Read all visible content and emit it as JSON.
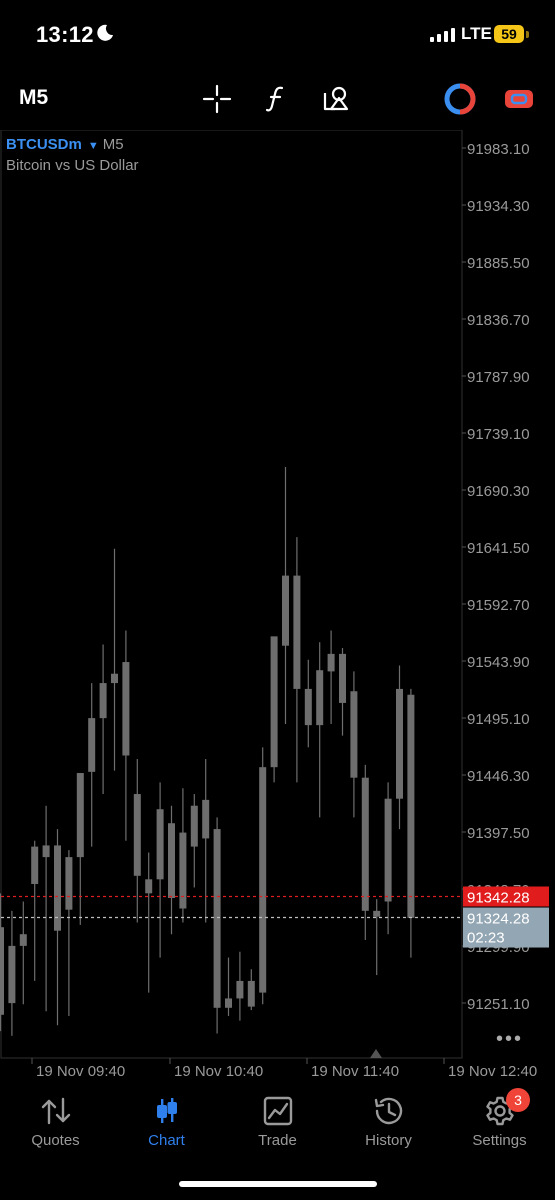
{
  "status_bar": {
    "time": "13:12",
    "network": "LTE",
    "battery": "59"
  },
  "toolbar": {
    "timeframe": "M5",
    "icons": [
      "crosshair-icon",
      "function-icon",
      "objects-icon",
      "trade-icon",
      "one-click-icon"
    ]
  },
  "chart": {
    "symbol": "BTCUSDm",
    "timeframe": "M5",
    "description": "Bitcoin vs US Dollar",
    "current_price": "91342.28",
    "second_price": "91324.28",
    "countdown": "02:23",
    "more_label": "•••"
  },
  "chart_data": {
    "type": "candlestick",
    "title": "",
    "y_ticks": [
      "91983.10",
      "91934.30",
      "91885.50",
      "91836.70",
      "91787.90",
      "91739.10",
      "91690.30",
      "91641.50",
      "91592.70",
      "91543.90",
      "91495.10",
      "91446.30",
      "91397.50",
      "91348.70",
      "91299.90",
      "91251.10"
    ],
    "x_ticks": [
      "19 Nov 09:40",
      "19 Nov 10:40",
      "19 Nov 11:40",
      "19 Nov 12:40"
    ],
    "ylim": [
      91225,
      92005
    ],
    "ask_line": 91342.28,
    "bid_line": 91324.28,
    "candles": [
      {
        "o": 91316,
        "h": 91345,
        "l": 91227,
        "c": 91241
      },
      {
        "o": 91251,
        "h": 91330,
        "l": 91223,
        "c": 91300
      },
      {
        "o": 91300,
        "h": 91338,
        "l": 91250,
        "c": 91310
      },
      {
        "o": 91353,
        "h": 91390,
        "l": 91270,
        "c": 91385
      },
      {
        "o": 91376,
        "h": 91420,
        "l": 91244,
        "c": 91386
      },
      {
        "o": 91386,
        "h": 91400,
        "l": 91232,
        "c": 91313
      },
      {
        "o": 91331,
        "h": 91382,
        "l": 91240,
        "c": 91376
      },
      {
        "o": 91376,
        "h": 91435,
        "l": 91318,
        "c": 91448
      },
      {
        "o": 91449,
        "h": 91525,
        "l": 91385,
        "c": 91495
      },
      {
        "o": 91495,
        "h": 91558,
        "l": 91430,
        "c": 91525
      },
      {
        "o": 91525,
        "h": 91640,
        "l": 91450,
        "c": 91533
      },
      {
        "o": 91543,
        "h": 91570,
        "l": 91390,
        "c": 91463
      },
      {
        "o": 91430,
        "h": 91460,
        "l": 91320,
        "c": 91360
      },
      {
        "o": 91345,
        "h": 91380,
        "l": 91260,
        "c": 91357
      },
      {
        "o": 91357,
        "h": 91440,
        "l": 91290,
        "c": 91417
      },
      {
        "o": 91405,
        "h": 91420,
        "l": 91310,
        "c": 91341
      },
      {
        "o": 91332,
        "h": 91435,
        "l": 91320,
        "c": 91397
      },
      {
        "o": 91385,
        "h": 91430,
        "l": 91350,
        "c": 91420
      },
      {
        "o": 91425,
        "h": 91460,
        "l": 91320,
        "c": 91392
      },
      {
        "o": 91400,
        "h": 91410,
        "l": 91225,
        "c": 91247
      },
      {
        "o": 91247,
        "h": 91290,
        "l": 91240,
        "c": 91255
      },
      {
        "o": 91255,
        "h": 91295,
        "l": 91236,
        "c": 91270
      },
      {
        "o": 91270,
        "h": 91280,
        "l": 91245,
        "c": 91248
      },
      {
        "o": 91260,
        "h": 91470,
        "l": 91250,
        "c": 91453
      },
      {
        "o": 91453,
        "h": 91545,
        "l": 91440,
        "c": 91565
      },
      {
        "o": 91557,
        "h": 91710,
        "l": 91490,
        "c": 91617
      },
      {
        "o": 91617,
        "h": 91650,
        "l": 91440,
        "c": 91520
      },
      {
        "o": 91520,
        "h": 91545,
        "l": 91470,
        "c": 91489
      },
      {
        "o": 91489,
        "h": 91560,
        "l": 91410,
        "c": 91536
      },
      {
        "o": 91550,
        "h": 91570,
        "l": 91490,
        "c": 91535
      },
      {
        "o": 91550,
        "h": 91555,
        "l": 91480,
        "c": 91508
      },
      {
        "o": 91518,
        "h": 91535,
        "l": 91410,
        "c": 91444
      },
      {
        "o": 91444,
        "h": 91455,
        "l": 91305,
        "c": 91330
      },
      {
        "o": 91330,
        "h": 91340,
        "l": 91275,
        "c": 91325
      },
      {
        "o": 91338,
        "h": 91440,
        "l": 91310,
        "c": 91426
      },
      {
        "o": 91426,
        "h": 91540,
        "l": 91400,
        "c": 91520
      },
      {
        "o": 91515,
        "h": 91520,
        "l": 91290,
        "c": 91324
      }
    ]
  },
  "nav": {
    "items": [
      {
        "label": "Quotes",
        "icon": "quotes-arrows-icon"
      },
      {
        "label": "Chart",
        "icon": "chart-candles-icon"
      },
      {
        "label": "Trade",
        "icon": "trade-chart-icon"
      },
      {
        "label": "History",
        "icon": "history-clock-icon"
      },
      {
        "label": "Settings",
        "icon": "settings-gear-icon"
      }
    ],
    "settings_badge": "3"
  },
  "colors": {
    "accent": "#2f80ed",
    "ask": "#e01c1c",
    "bid_bg": "#93a6b3",
    "candle": "#6e6e6e",
    "grid": "#2f2f2f"
  }
}
